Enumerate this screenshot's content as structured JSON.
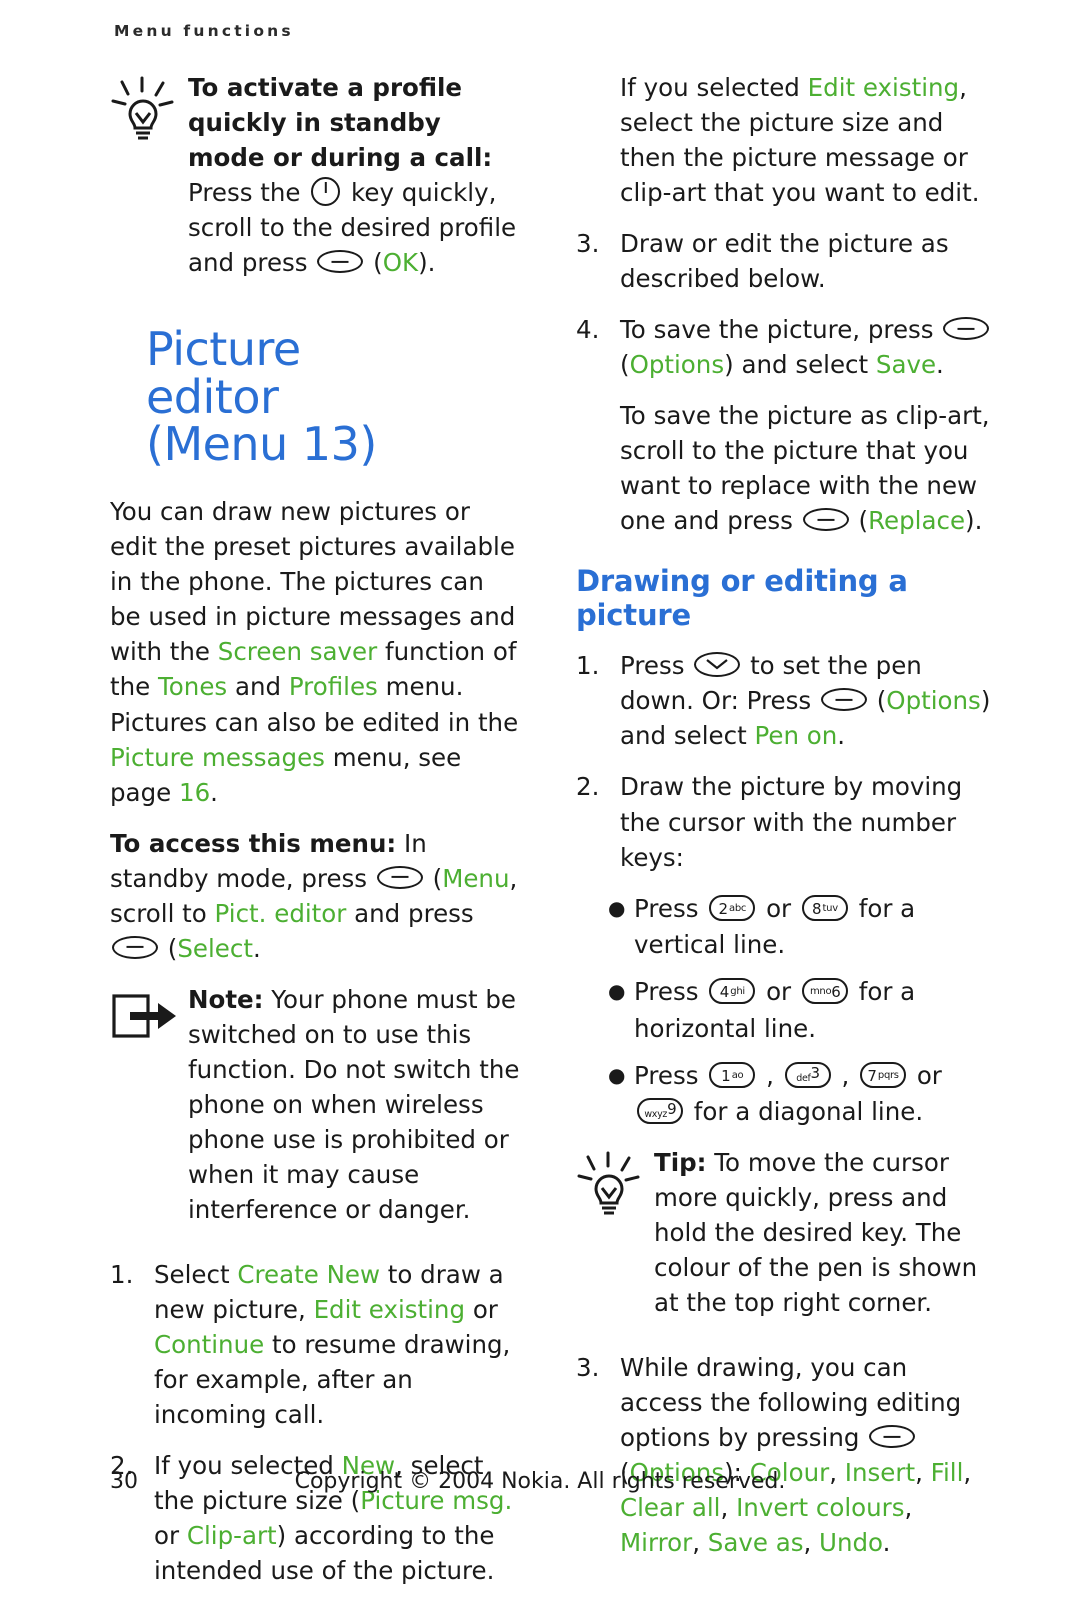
{
  "header": {
    "running_head": "Menu functions"
  },
  "left": {
    "tip1": {
      "lead": "To activate a profile quickly in standby mode or during a call:",
      "rest_1": " Press the ",
      "rest_2": " key quickly, scroll to the desired profile and press ",
      "rest_3": " (",
      "ok": "OK",
      "rest_4": ")."
    },
    "title": {
      "line1": "Picture",
      "line2": "editor",
      "line3": "(Menu 13)"
    },
    "intro_1": "You can draw new pictures or edit the preset pictures available in the phone. The pictures can be used in picture messages and with the ",
    "intro_screen_saver": "Screen saver",
    "intro_2": " function of the ",
    "intro_tones": "Tones",
    "intro_3": " and ",
    "intro_profiles": "Profiles",
    "intro_4": " menu. Pictures can also be edited in the ",
    "intro_picture_messages": "Picture messages",
    "intro_5": " menu, see page ",
    "intro_page_ref": "16",
    "intro_6": ".",
    "access_lead": "To access this menu:",
    "access_1": " In standby mode, press ",
    "access_menu": "Menu",
    "access_2": ", scroll to ",
    "access_pict_editor": "Pict. editor",
    "access_3": " and press ",
    "access_select": "Select",
    "access_4": ".",
    "note_lead": "Note:",
    "note_body": " Your phone must be switched on to use this function. Do not switch the phone on when wireless phone use is prohibited or when it may cause interference or danger.",
    "step1_num": "1.",
    "step1_a": "Select ",
    "step1_create_new": "Create New",
    "step1_b": " to draw a new picture, ",
    "step1_edit_existing": "Edit existing",
    "step1_c": " or ",
    "step1_continue": "Continue",
    "step1_d": " to resume drawing, for example, after an incoming call.",
    "step2_num": "2.",
    "step2_a": "If you selected ",
    "step2_new": "New",
    "step2_b": ", select the picture size (",
    "step2_picture_msg": "Picture msg.",
    "step2_c": " or ",
    "step2_clipart": "Clip-art",
    "step2_d": ") according to the intended use of the picture."
  },
  "right": {
    "edit_a": "If you selected ",
    "edit_existing": "Edit existing",
    "edit_b": ", select the picture size and then the picture message or clip-art that you want to edit.",
    "step3_num": "3.",
    "step3_text": "Draw or edit the picture as described below.",
    "step4_num": "4.",
    "step4_a": "To save the picture, press ",
    "step4_b": " (",
    "step4_options": "Options",
    "step4_c": ") and select ",
    "step4_save": "Save",
    "step4_d": ".",
    "clipart_a": "To save the picture as clip-art, scroll to the picture that you want to replace with the new one and press ",
    "clipart_b": " (",
    "clipart_replace": "Replace",
    "clipart_c": ").",
    "subhead": "Drawing or editing a picture",
    "d1_num": "1.",
    "d1_a": "Press ",
    "d1_b": " to set the pen down. Or: Press ",
    "d1_c": " (",
    "d1_options": "Options",
    "d1_d": ") and select ",
    "d1_pen_on": "Pen on",
    "d1_e": ".",
    "d2_num": "2.",
    "d2_text": "Draw the picture by moving the cursor with the number keys:",
    "b1_a": "Press ",
    "b1_key1_big": "2",
    "b1_key1_small": "abc",
    "b1_or": " or ",
    "b1_key2_big": "8",
    "b1_key2_small": "tuv",
    "b1_b": " for a vertical line.",
    "b2_a": "Press ",
    "b2_key1_big": "4",
    "b2_key1_small": "ghi",
    "b2_or": " or ",
    "b2_key2_big": "6",
    "b2_key2_small": "mno",
    "b2_b": " for a horizontal line.",
    "b3_a": "Press ",
    "b3_key1_big": "1",
    "b3_key1_small": "ao",
    "b3_sep1": " , ",
    "b3_key2_big": "3",
    "b3_key2_small": "def",
    "b3_sep2": " , ",
    "b3_key3_big": "7",
    "b3_key3_small": "pqrs",
    "b3_or": " or ",
    "b3_key4_big": "9",
    "b3_key4_small": "wxyz",
    "b3_b": " for a diagonal line.",
    "tip_lead": "Tip:",
    "tip_body": " To move the cursor more quickly, press and hold the desired key. The colour of the pen is shown at the top right corner.",
    "d3_num": "3.",
    "d3_a": "While drawing, you can access the following editing options by pressing ",
    "d3_b": " (",
    "d3_options": "Options",
    "d3_c": "): ",
    "d3_colour": "Colour",
    "d3_s1": ", ",
    "d3_insert": "Insert",
    "d3_s2": ", ",
    "d3_fill": "Fill",
    "d3_s3": ", ",
    "d3_clear_all": "Clear all",
    "d3_s4": ", ",
    "d3_invert_colours": "Invert colours",
    "d3_s5": ", ",
    "d3_mirror": "Mirror",
    "d3_s6": ", ",
    "d3_save_as": "Save as",
    "d3_s7": ", ",
    "d3_undo": "Undo",
    "d3_s8": "."
  },
  "footer": {
    "page_number": "30",
    "copyright": "Copyright © 2004 Nokia. All rights reserved."
  },
  "colors": {
    "green": "#4caf32",
    "blue": "#2a6fd4",
    "text": "#1a1a1a"
  }
}
